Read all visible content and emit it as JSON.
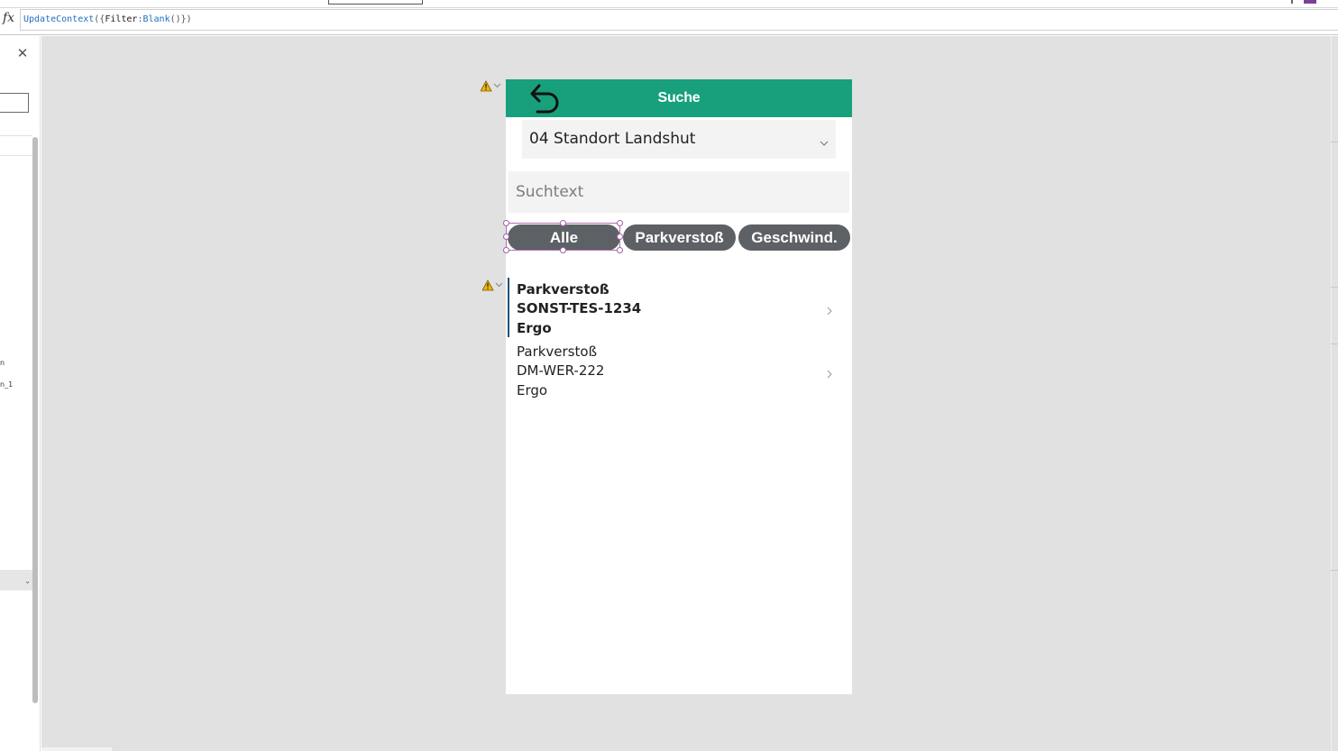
{
  "formula_bar": {
    "fx_icon": "fx-icon",
    "tokens": [
      {
        "text": "UpdateContext",
        "kind": "fn"
      },
      {
        "text": "({",
        "kind": "p"
      },
      {
        "text": "Filter",
        "kind": "id"
      },
      {
        "text": ":",
        "kind": "p"
      },
      {
        "text": "Blank",
        "kind": "fn"
      },
      {
        "text": "()})",
        "kind": "p"
      }
    ]
  },
  "left_panel": {
    "close_icon": "close-icon",
    "labels": [
      "n",
      "n_1"
    ]
  },
  "app": {
    "header": {
      "title": "Suche",
      "back_icon": "back-arrow-icon",
      "color": "#17a07b"
    },
    "location_dropdown": {
      "value": "04 Standort Landshut"
    },
    "search": {
      "placeholder": "Suchtext"
    },
    "filters": [
      "Alle",
      "Parkverstoß",
      "Geschwind."
    ],
    "selected_filter": "Alle",
    "records": [
      {
        "type": "Parkverstoß",
        "plate": "SONST-TES-1234",
        "insurer": "Ergo",
        "selected": true
      },
      {
        "type": "Parkverstoß",
        "plate": "DM-WER-222",
        "insurer": "Ergo",
        "selected": false
      }
    ]
  },
  "colors": {
    "canvas": "#e1e1e1",
    "pill": "#5d6064",
    "selection_frame": "#b070b0",
    "selected_bar": "#20527a"
  }
}
